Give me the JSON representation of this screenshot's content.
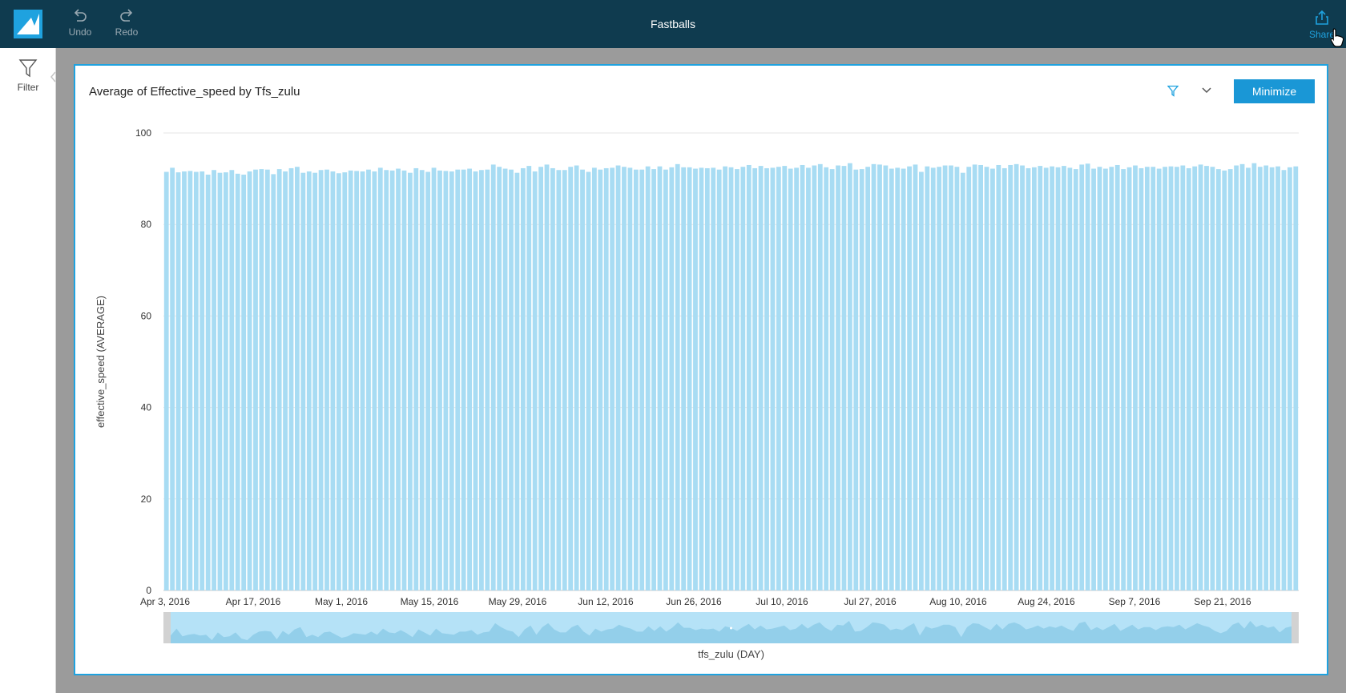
{
  "app": {
    "title": "Fastballs"
  },
  "toolbar": {
    "undo_label": "Undo",
    "redo_label": "Redo",
    "share_label": "Share"
  },
  "sidebar": {
    "filter_label": "Filter"
  },
  "visual": {
    "title": "Average of Effective_speed by Tfs_zulu",
    "minimize_label": "Minimize"
  },
  "colors": {
    "bar": "#a8dcf3",
    "accent": "#1fa2df",
    "topbar": "#0f3b4f"
  },
  "icons": [
    "logo-icon",
    "undo-icon",
    "redo-icon",
    "share-icon",
    "filter-icon",
    "chevron-left-icon",
    "chevron-down-icon"
  ],
  "chart_data": {
    "type": "bar",
    "title": "Average of Effective_speed by Tfs_zulu",
    "xlabel": "tfs_zulu (DAY)",
    "ylabel": "effective_speed (AVERAGE)",
    "ylim": [
      0,
      100
    ],
    "yticks": [
      0,
      20,
      40,
      60,
      80,
      100
    ],
    "xtick_labels": [
      "Apr 3, 2016",
      "Apr 17, 2016",
      "May 1, 2016",
      "May 15, 2016",
      "May 29, 2016",
      "Jun 12, 2016",
      "Jun 26, 2016",
      "Jul 10, 2016",
      "Jul 27, 2016",
      "Aug 10, 2016",
      "Aug 24, 2016",
      "Sep 7, 2016",
      "Sep 21, 2016"
    ],
    "grid": true,
    "values": [
      91.5,
      92.4,
      91.4,
      91.6,
      91.7,
      91.5,
      91.6,
      90.9,
      91.9,
      91.3,
      91.4,
      91.9,
      91.1,
      90.9,
      91.6,
      92.0,
      92.1,
      92.0,
      91.0,
      92.1,
      91.6,
      92.3,
      92.6,
      91.3,
      91.6,
      91.3,
      91.9,
      92.0,
      91.6,
      91.2,
      91.4,
      91.8,
      91.7,
      91.6,
      92.0,
      91.6,
      92.4,
      91.9,
      91.8,
      92.2,
      91.8,
      91.3,
      92.3,
      91.9,
      91.5,
      92.4,
      91.8,
      91.7,
      91.6,
      92.0,
      92.0,
      92.2,
      91.6,
      91.9,
      92.0,
      93.1,
      92.6,
      92.2,
      92.0,
      91.3,
      92.3,
      92.8,
      91.6,
      92.6,
      93.1,
      92.3,
      91.9,
      91.9,
      92.6,
      92.9,
      92.0,
      91.5,
      92.4,
      92.0,
      92.3,
      92.4,
      92.9,
      92.6,
      92.4,
      92.0,
      92.0,
      92.7,
      92.1,
      92.7,
      92.0,
      92.5,
      93.2,
      92.5,
      92.5,
      92.2,
      92.4,
      92.3,
      92.4,
      92.0,
      92.7,
      92.5,
      92.1,
      92.6,
      93.0,
      92.3,
      92.8,
      92.3,
      92.4,
      92.6,
      92.8,
      92.2,
      92.4,
      93.0,
      92.4,
      92.9,
      93.2,
      92.5,
      92.1,
      92.9,
      92.8,
      93.4,
      92.0,
      92.1,
      92.6,
      93.2,
      93.1,
      92.9,
      92.2,
      92.4,
      92.2,
      92.7,
      93.1,
      91.5,
      92.7,
      92.4,
      92.6,
      92.9,
      92.9,
      92.6,
      91.3,
      92.6,
      93.1,
      93.0,
      92.6,
      92.2,
      93.0,
      92.3,
      93.0,
      93.2,
      92.9,
      92.3,
      92.5,
      92.8,
      92.4,
      92.7,
      92.5,
      92.8,
      92.4,
      92.1,
      93.1,
      93.3,
      92.2,
      92.6,
      92.2,
      92.6,
      93.0,
      92.1,
      92.5,
      92.9,
      92.3,
      92.6,
      92.6,
      92.2,
      92.6,
      92.7,
      92.6,
      92.9,
      92.3,
      92.7,
      93.1,
      92.8,
      92.6,
      92.1,
      91.8,
      92.1,
      92.9,
      93.2,
      92.4,
      93.4,
      92.6,
      92.9,
      92.5,
      92.7,
      91.9,
      92.5,
      92.7
    ]
  }
}
